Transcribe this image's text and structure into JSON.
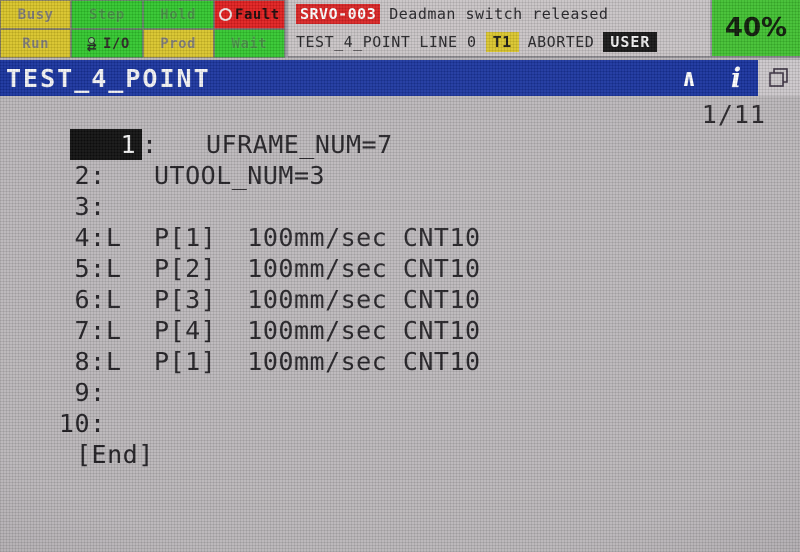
{
  "colors": {
    "title_bar": "#15309c",
    "alarm_red": "#d81f1f",
    "status_green": "#2ec52a",
    "status_yellow": "#d8c326",
    "fault_red": "#e01a1a",
    "override_green": "#3fbf2f",
    "lcd_background": "#b9b5b8"
  },
  "status_grid": {
    "cells": [
      {
        "label": "Busy",
        "state": "off",
        "color": "#d8c326"
      },
      {
        "label": "Step",
        "state": "off",
        "color": "#2ec52a"
      },
      {
        "label": "Hold",
        "state": "off",
        "color": "#2ec52a"
      },
      {
        "label": "Fault",
        "state": "on",
        "color": "#e01a1a"
      },
      {
        "label": "Run",
        "state": "off",
        "color": "#d8c326"
      },
      {
        "label": "I/O",
        "state": "on",
        "color": "#2ec52a"
      },
      {
        "label": "Prod",
        "state": "off",
        "color": "#d8c326"
      },
      {
        "label": "Wait",
        "state": "off",
        "color": "#2ec52a"
      }
    ]
  },
  "alarm": {
    "code": "SRVO-003",
    "message": "Deadman switch released"
  },
  "mode_line": {
    "program": "TEST_4_POINT",
    "line_label": "LINE 0",
    "tmode": "T1",
    "run_state": "ABORTED",
    "user_badge": "USER"
  },
  "override": {
    "value": "40%"
  },
  "title_bar": {
    "title": "TEST_4_POINT",
    "icons": [
      {
        "name": "caret-up-icon",
        "glyph": "∧"
      },
      {
        "name": "info-icon",
        "glyph": "i"
      },
      {
        "name": "window-switch-icon",
        "glyph": "❐"
      }
    ]
  },
  "page_indicator": "1/11",
  "program": {
    "lines": [
      {
        "num": "1",
        "colon": ":",
        "motion": "",
        "text": "UFRAME_NUM=7",
        "cursor": true
      },
      {
        "num": "2",
        "colon": ":",
        "motion": "",
        "text": "UTOOL_NUM=3",
        "cursor": false
      },
      {
        "num": "3",
        "colon": ":",
        "motion": "",
        "text": "",
        "cursor": false
      },
      {
        "num": "4",
        "colon": ":",
        "motion": "L",
        "text": "P[1]  100mm/sec CNT10",
        "cursor": false
      },
      {
        "num": "5",
        "colon": ":",
        "motion": "L",
        "text": "P[2]  100mm/sec CNT10",
        "cursor": false
      },
      {
        "num": "6",
        "colon": ":",
        "motion": "L",
        "text": "P[3]  100mm/sec CNT10",
        "cursor": false
      },
      {
        "num": "7",
        "colon": ":",
        "motion": "L",
        "text": "P[4]  100mm/sec CNT10",
        "cursor": false
      },
      {
        "num": "8",
        "colon": ":",
        "motion": "L",
        "text": "P[1]  100mm/sec CNT10",
        "cursor": false
      },
      {
        "num": "9",
        "colon": ":",
        "motion": "",
        "text": "",
        "cursor": false
      },
      {
        "num": "10",
        "colon": ":",
        "motion": "",
        "text": "",
        "cursor": false
      }
    ],
    "end_marker": "[End]"
  }
}
